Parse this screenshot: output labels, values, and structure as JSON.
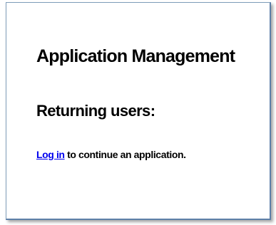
{
  "page": {
    "title": "Application Management",
    "subtitle": "Returning users:",
    "login_link_text": "Log in",
    "login_suffix_text": " to continue an application."
  },
  "colors": {
    "link": "#0000ee",
    "text": "#000000",
    "border": "#7f9db9",
    "background": "#ffffff"
  }
}
